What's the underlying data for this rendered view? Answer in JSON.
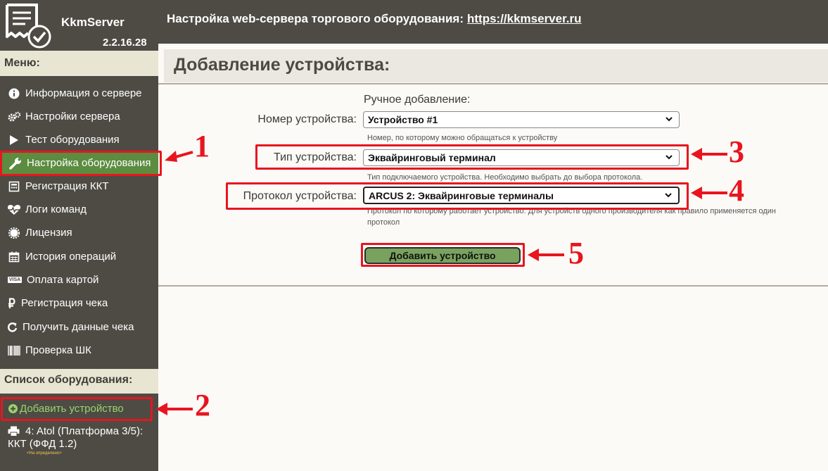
{
  "app": {
    "name": "KkmServer",
    "version": "2.2.16.28"
  },
  "header": {
    "title": "Настройка web-сервера торгового оборудования:",
    "link": "https://kkmserver.ru"
  },
  "sidebar": {
    "menu_heading": "Меню:",
    "items": [
      {
        "label": "Информация о сервере",
        "icon": "info-icon"
      },
      {
        "label": "Настройки сервера",
        "icon": "gears-icon"
      },
      {
        "label": "Тест оборудования",
        "icon": "play-icon"
      },
      {
        "label": "Настройка оборудования",
        "icon": "wrench-icon",
        "active": true
      },
      {
        "label": "Регистрация ККТ",
        "icon": "calculator-icon"
      },
      {
        "label": "Логи команд",
        "icon": "heartbeat-icon"
      },
      {
        "label": "Лицензия",
        "icon": "certificate-icon"
      },
      {
        "label": "История операций",
        "icon": "calendar-icon"
      },
      {
        "label": "Оплата картой",
        "icon": "visa-card-icon",
        "badge": "VISA"
      },
      {
        "label": "Регистрация чека",
        "icon": "ruble-icon"
      },
      {
        "label": "Получить данные чека",
        "icon": "refresh-icon"
      },
      {
        "label": "Проверка ШК",
        "icon": "barcode-icon"
      }
    ],
    "equipment_heading": "Список оборудования:",
    "add_device": "Добавить устройство",
    "device_line1": "4: Atol (Платформа 3/5):",
    "device_line2": "ККТ (ФФД 1.2)",
    "device_status": "<На определено>"
  },
  "main": {
    "title": "Добавление устройства:",
    "section_label": "Ручное добавление:",
    "number_label": "Номер устройства:",
    "number_value": "Устройство #1",
    "number_hint": "Номер, по которому можно обращаться к устройству",
    "type_label": "Тип устройства:",
    "type_value": "Эквайринговый терминал",
    "type_hint": "Тип подключаемого устройства. Необходимо выбрать до выбора протокола.",
    "protocol_label": "Протокол устройства:",
    "protocol_value": "ARCUS 2: Эквайринговые терминалы",
    "protocol_hint_line1": "Протокол по которому работает устройство. Для устройств одного производителя как правило применяется один",
    "protocol_hint_line2": "протокол",
    "add_button": "Добавить устройство"
  },
  "annotations": [
    "1",
    "2",
    "3",
    "4",
    "5"
  ],
  "colors": {
    "accent_red": "#e8151f",
    "active_green": "#5b8c3f",
    "button_green": "#79a25f",
    "sidebar_bg": "#4d4b44",
    "add_link_green": "#9ad36c"
  }
}
